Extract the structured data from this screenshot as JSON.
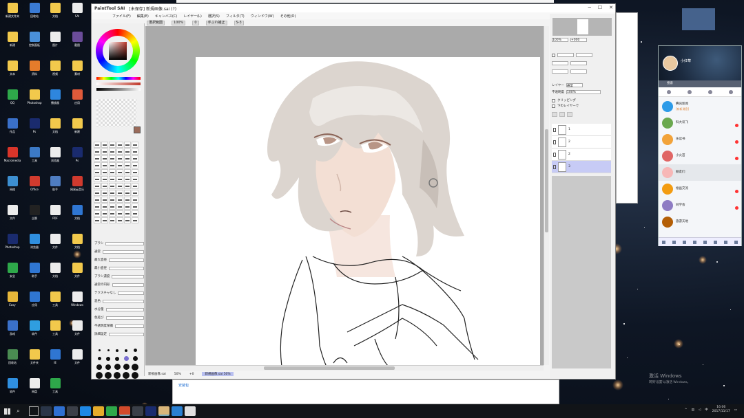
{
  "sai": {
    "title_logo": "PaintTool SAI",
    "doc_title": "[未保存] 新規画像.sai (?)",
    "menus": [
      "ファイル(F)",
      "編集(E)",
      "キャンバス(C)",
      "レイヤー(L)",
      "選択(S)",
      "フィルタ(T)",
      "ウィンドウ(W)",
      "その他(O)"
    ],
    "toolbar": [
      "選択範囲",
      "100%",
      "0",
      "手ぶれ補正",
      "S-3"
    ],
    "left_panel": {
      "props": [
        "ブラシ",
        "通常",
        "最大直径",
        "最小直径",
        "ブラシ濃度",
        "通常の円形",
        "テクスチャなし",
        "混色",
        "水分量",
        "色延び",
        "不透明度保護",
        "詳細設定"
      ],
      "size_labels": []
    },
    "status_bar": {
      "left": "新規画像.sai",
      "zoom": "50%",
      "angle": "+0",
      "selected": "新規画像.sai",
      "selected_zoom": "50%",
      "memory": "メモリ使用率 25%(32%)"
    },
    "right_panel": {
      "nav_zoom": "100%",
      "nav_angle": "+000",
      "layer_title": "レイヤー",
      "mode_label": "通常",
      "opacity_label": "不透明度",
      "opacity_value": "100%",
      "check1": "クリッピング",
      "check2": "下のレイヤーで",
      "layers": [
        {
          "name": "1",
          "sub": "",
          "active": false
        },
        {
          "name": "2",
          "sub": "",
          "active": false
        },
        {
          "name": "2",
          "sub": "",
          "active": false
        },
        {
          "name": "3",
          "sub": "",
          "active": true
        }
      ]
    }
  },
  "qq": {
    "name": "小红莓",
    "search_placeholder": "搜索",
    "contacts": [
      {
        "name": "腾讯新闻",
        "msg": "[有新消息]",
        "time": "",
        "color": "#2d9be8",
        "unread": false
      },
      {
        "name": "科大讯飞",
        "msg": "",
        "time": "",
        "color": "#6aa84f",
        "unread": true
      },
      {
        "name": "乐读书",
        "msg": "",
        "time": "",
        "color": "#f2a33a",
        "unread": true
      },
      {
        "name": "小火苗",
        "msg": "",
        "time": "",
        "color": "#e06666",
        "unread": true
      },
      {
        "name": "朋友们",
        "msg": "",
        "time": "",
        "color": "#f7b7b7",
        "unread": false
      },
      {
        "name": "绘画交流",
        "msg": "",
        "time": "",
        "color": "#f39c12",
        "unread": true
      },
      {
        "name": "同学会",
        "msg": "",
        "time": "",
        "color": "#8e7cc3",
        "unread": true
      },
      {
        "name": "旅游天地",
        "msg": "",
        "time": "",
        "color": "#b45f06",
        "unread": false
      }
    ]
  },
  "desktop": {
    "icons": [
      {
        "label": "新建文件夹",
        "color": "#f2c94c"
      },
      {
        "label": "回收站",
        "color": "#3a7bd5"
      },
      {
        "label": "文档",
        "color": "#f2c94c"
      },
      {
        "label": "SAI",
        "color": "#ececec"
      },
      {
        "label": "新建",
        "color": "#f2c94c"
      },
      {
        "label": "控制面板",
        "color": "#4a90d9"
      },
      {
        "label": "图片",
        "color": "#ececec"
      },
      {
        "label": "截图",
        "color": "#6b4c9a"
      },
      {
        "label": "文本",
        "color": "#f2c94c"
      },
      {
        "label": "资料",
        "color": "#e57c2b"
      },
      {
        "label": "视频",
        "color": "#f2c94c"
      },
      {
        "label": "素材",
        "color": "#f2c94c"
      },
      {
        "label": "QQ",
        "color": "#2ea84a"
      },
      {
        "label": "Photoshop",
        "color": "#f2c94c"
      },
      {
        "label": "播放器",
        "color": "#2e86de"
      },
      {
        "label": "应用",
        "color": "#e05a3a"
      },
      {
        "label": "作品",
        "color": "#3a70c9"
      },
      {
        "label": "Ps",
        "color": "#1a2b6e"
      },
      {
        "label": "文档",
        "color": "#f2c94c"
      },
      {
        "label": "新建",
        "color": "#f2c94c"
      },
      {
        "label": "Macromedia",
        "color": "#d9352a"
      },
      {
        "label": "工具",
        "color": "#3c7ac6"
      },
      {
        "label": "浏览器",
        "color": "#ececec"
      },
      {
        "label": "Ps",
        "color": "#1a2b6e"
      },
      {
        "label": "网络",
        "color": "#3d8fd1"
      },
      {
        "label": "Office",
        "color": "#d13b2e"
      },
      {
        "label": "助手",
        "color": "#4f7dc1"
      },
      {
        "label": "网易云音乐",
        "color": "#d03a2e"
      },
      {
        "label": "文件",
        "color": "#ececec"
      },
      {
        "label": "企鹅",
        "color": "#222"
      },
      {
        "label": "PDF",
        "color": "#ececec"
      },
      {
        "label": "文档",
        "color": "#2f76d2"
      },
      {
        "label": "Photoshop",
        "color": "#1a2b6e"
      },
      {
        "label": "浏览器",
        "color": "#2f8fe0"
      },
      {
        "label": "文件",
        "color": "#ececec"
      },
      {
        "label": "文档",
        "color": "#f2c94c"
      },
      {
        "label": "安全",
        "color": "#2ea84a"
      },
      {
        "label": "助手",
        "color": "#2f76d2"
      },
      {
        "label": "文档",
        "color": "#ececec"
      },
      {
        "label": "文件",
        "color": "#f2c94c"
      },
      {
        "label": "Easy",
        "color": "#e7b73a"
      },
      {
        "label": "应用",
        "color": "#2f76d2"
      },
      {
        "label": "工具",
        "color": "#f2c94c"
      },
      {
        "label": "Windows",
        "color": "#ececec"
      },
      {
        "label": "游戏",
        "color": "#3a70c9"
      },
      {
        "label": "软件",
        "color": "#2f9ee0"
      },
      {
        "label": "工具",
        "color": "#f2c94c"
      },
      {
        "label": "文件",
        "color": "#ececec"
      },
      {
        "label": "回收站",
        "color": "#4a8c52"
      },
      {
        "label": "文件夹",
        "color": "#f2c94c"
      },
      {
        "label": "IE",
        "color": "#2f76d2"
      },
      {
        "label": "文件",
        "color": "#ececec"
      },
      {
        "label": "软件",
        "color": "#2f8fe0"
      },
      {
        "label": "网盘",
        "color": "#ececec"
      },
      {
        "label": "工具",
        "color": "#2ea84a"
      }
    ]
  },
  "bg_window": {
    "bottom_text": "安装包"
  },
  "watermark": {
    "line1": "激活 Windows",
    "line2": "转到'设置'以激活 Windows。"
  },
  "taskbar": {
    "apps": [
      {
        "color": "#2a3548",
        "active": false
      },
      {
        "color": "#2f6fd1",
        "active": false
      },
      {
        "color": "#3b3f48",
        "active": false
      },
      {
        "color": "#1e88e5",
        "active": false
      },
      {
        "color": "#e5ac2b",
        "active": false
      },
      {
        "color": "#2ea84a",
        "active": false
      },
      {
        "color": "#d24a2b",
        "active": true
      },
      {
        "color": "#3a3f48",
        "active": false
      },
      {
        "color": "#1a2b6e",
        "active": false
      },
      {
        "color": "#d9b67a",
        "active": true
      },
      {
        "color": "#2a80d2",
        "active": false
      },
      {
        "color": "#e0e0e0",
        "active": false
      }
    ],
    "tray_lang": "中",
    "time": "16:06",
    "date": "2017/11/17"
  },
  "colors": {
    "canvas_bg": "#aaaaaa",
    "layer_active": "#c7cbf5",
    "taskbar": "#111418"
  }
}
